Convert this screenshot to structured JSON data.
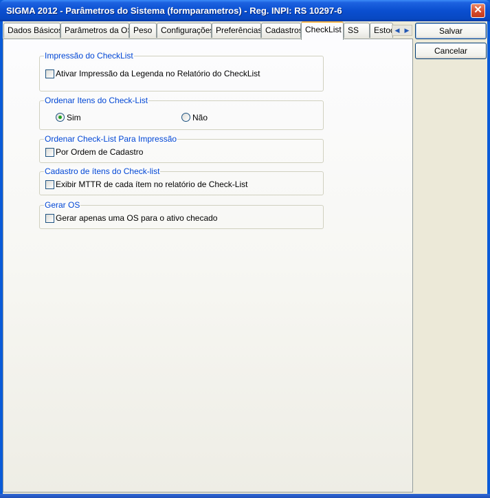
{
  "window": {
    "title": "SIGMA 2012 - Parâmetros do Sistema  (formparametros)  - Reg. INPI: RS 10297-6",
    "close_glyph": "✕"
  },
  "tabs": [
    {
      "label": "Dados Básicos"
    },
    {
      "label": "Parâmetros da OS"
    },
    {
      "label": "Peso"
    },
    {
      "label": "Configurações"
    },
    {
      "label": "Preferências"
    },
    {
      "label": "Cadastros"
    },
    {
      "label": "CheckList",
      "active": true
    },
    {
      "label": "SS"
    },
    {
      "label": "Estoque"
    }
  ],
  "tab_scroll": {
    "left_glyph": "◀",
    "right_glyph": "▶"
  },
  "groups": {
    "impressao": {
      "title": "Impressão do CheckList",
      "checkbox_label": "Ativar Impressão da Legenda no Relatório do CheckList",
      "checked": false
    },
    "ordenar_itens": {
      "title": "Ordenar Itens do Check-List",
      "options": [
        {
          "label": "Sim",
          "selected": true
        },
        {
          "label": "Não",
          "selected": false
        }
      ]
    },
    "ordenar_impressao": {
      "title": "Ordenar Check-List Para Impressão",
      "checkbox_label": "Por Ordem de Cadastro",
      "checked": false
    },
    "cadastro_itens": {
      "title": "Cadastro de ítens do Check-list",
      "checkbox_label": "Exibir MTTR de cada ítem no relatório de Check-List",
      "checked": false
    },
    "gerar_os": {
      "title": "Gerar OS",
      "checkbox_label": "Gerar apenas uma OS para o ativo checado",
      "checked": false
    }
  },
  "buttons": {
    "save": "Salvar",
    "cancel": "Cancelar"
  }
}
